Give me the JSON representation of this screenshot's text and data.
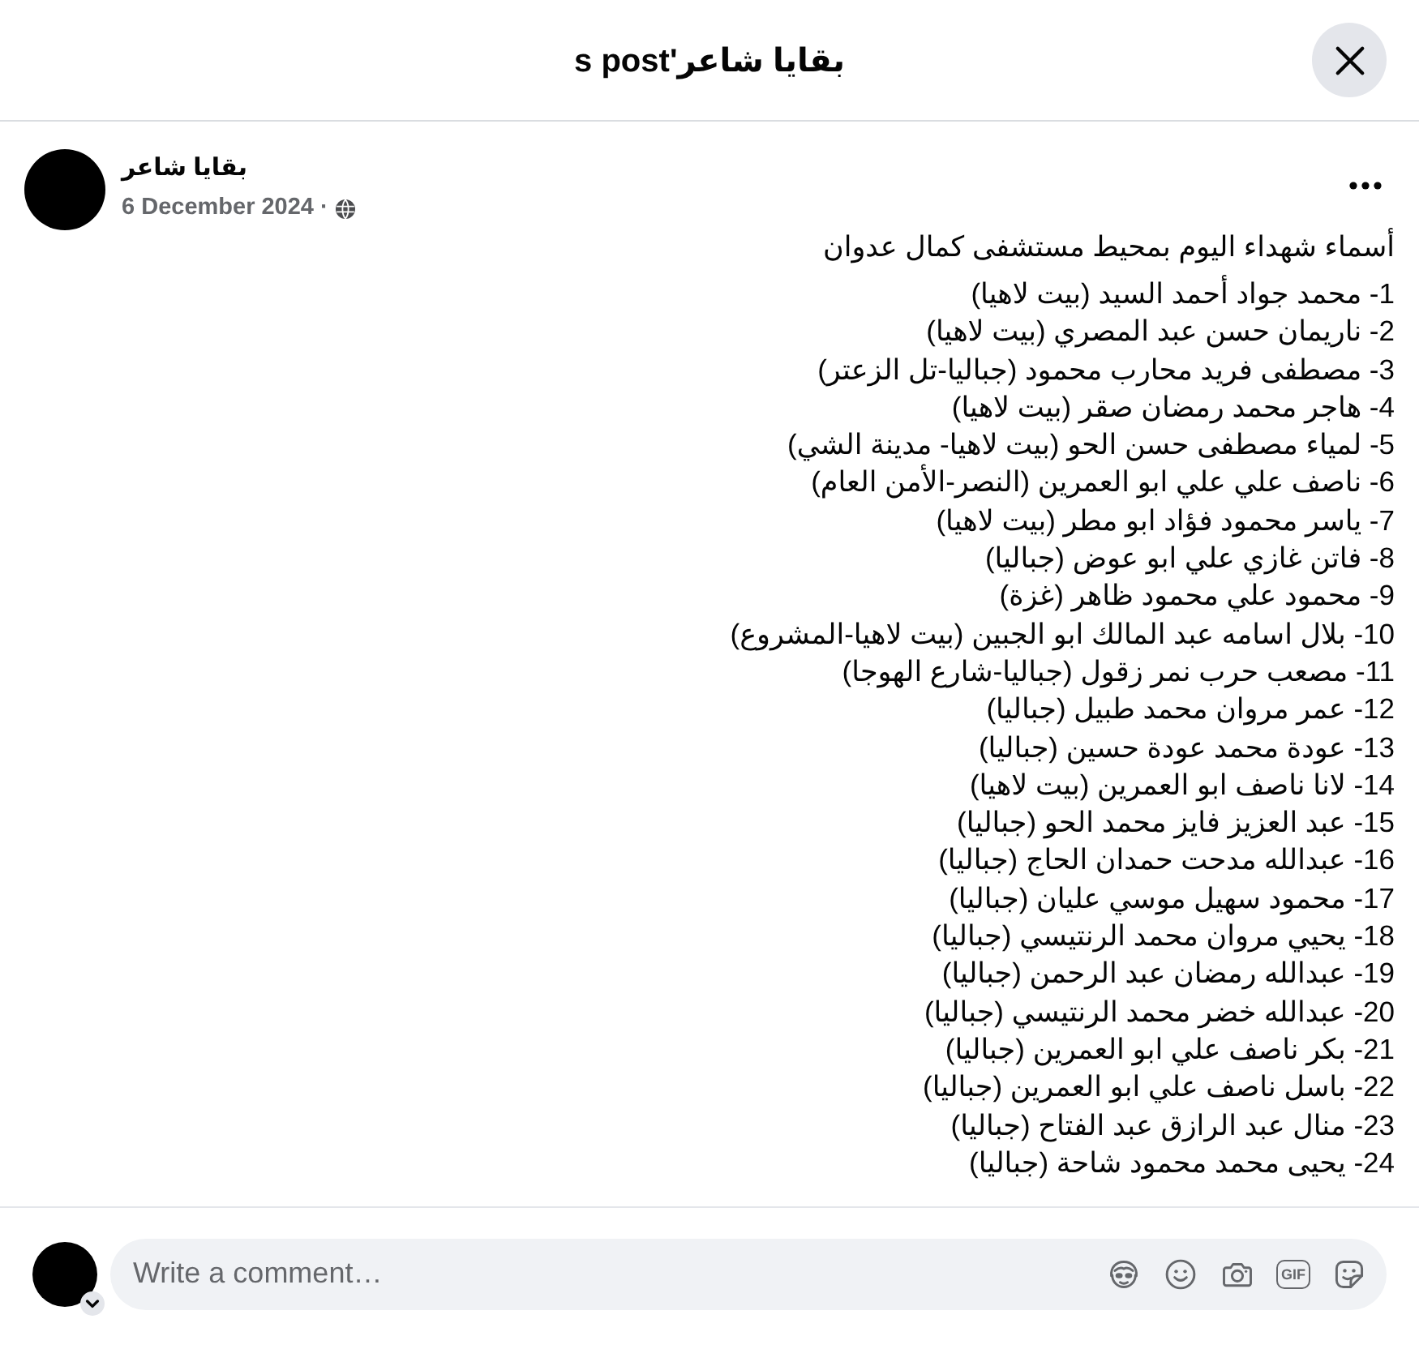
{
  "header": {
    "title": "بقايا شاعر's post"
  },
  "post": {
    "author": "بقايا شاعر",
    "date": "6 December 2024",
    "separator": "·",
    "intro": "أسماء شهداء اليوم بمحيط مستشفى كمال عدوان",
    "items": [
      "1- محمد جواد أحمد السيد (بيت لاهيا)",
      "2- ناريمان حسن عبد المصري (بيت لاهيا)",
      "3- مصطفى فريد محارب محمود (جباليا-تل الزعتر)",
      "4- هاجر محمد رمضان صقر (بيت لاهيا)",
      "5- لمياء مصطفى حسن الحو (بيت لاهيا- مدينة الشي)",
      "6- ناصف علي علي ابو العمرين (النصر-الأمن العام)",
      "7- ياسر محمود فؤاد ابو مطر (بيت لاهيا)",
      "8- فاتن غازي علي ابو عوض (جباليا)",
      "9- محمود علي محمود ظاهر (غزة)",
      "10- بلال اسامه عبد المالك ابو الجبين (بيت لاهيا-المشروع)",
      "11- مصعب حرب نمر زقول (جباليا-شارع الهوجا)",
      "12- عمر مروان محمد طبيل (جباليا)",
      "13- عودة محمد عودة حسين (جباليا)",
      "14- لانا ناصف ابو العمرين (بيت لاهيا)",
      "15- عبد العزيز فايز محمد الحو (جباليا)",
      "16- عبدالله مدحت حمدان الحاج (جباليا)",
      "17- محمود سهيل موسي عليان (جباليا)",
      "18- يحيي مروان محمد الرنتيسي (جباليا)",
      "19- عبدالله رمضان عبد الرحمن (جباليا)",
      "20- عبدالله خضر محمد الرنتيسي (جباليا)",
      "21- بكر ناصف علي ابو العمرين (جباليا)",
      "22- باسل ناصف علي ابو العمرين (جباليا)",
      "23- منال عبد الرازق عبد الفتاح (جباليا)",
      "24- يحيى محمد محمود شاحة (جباليا)"
    ]
  },
  "comment_box": {
    "placeholder": "Write a comment…",
    "gif_label": "GIF"
  }
}
